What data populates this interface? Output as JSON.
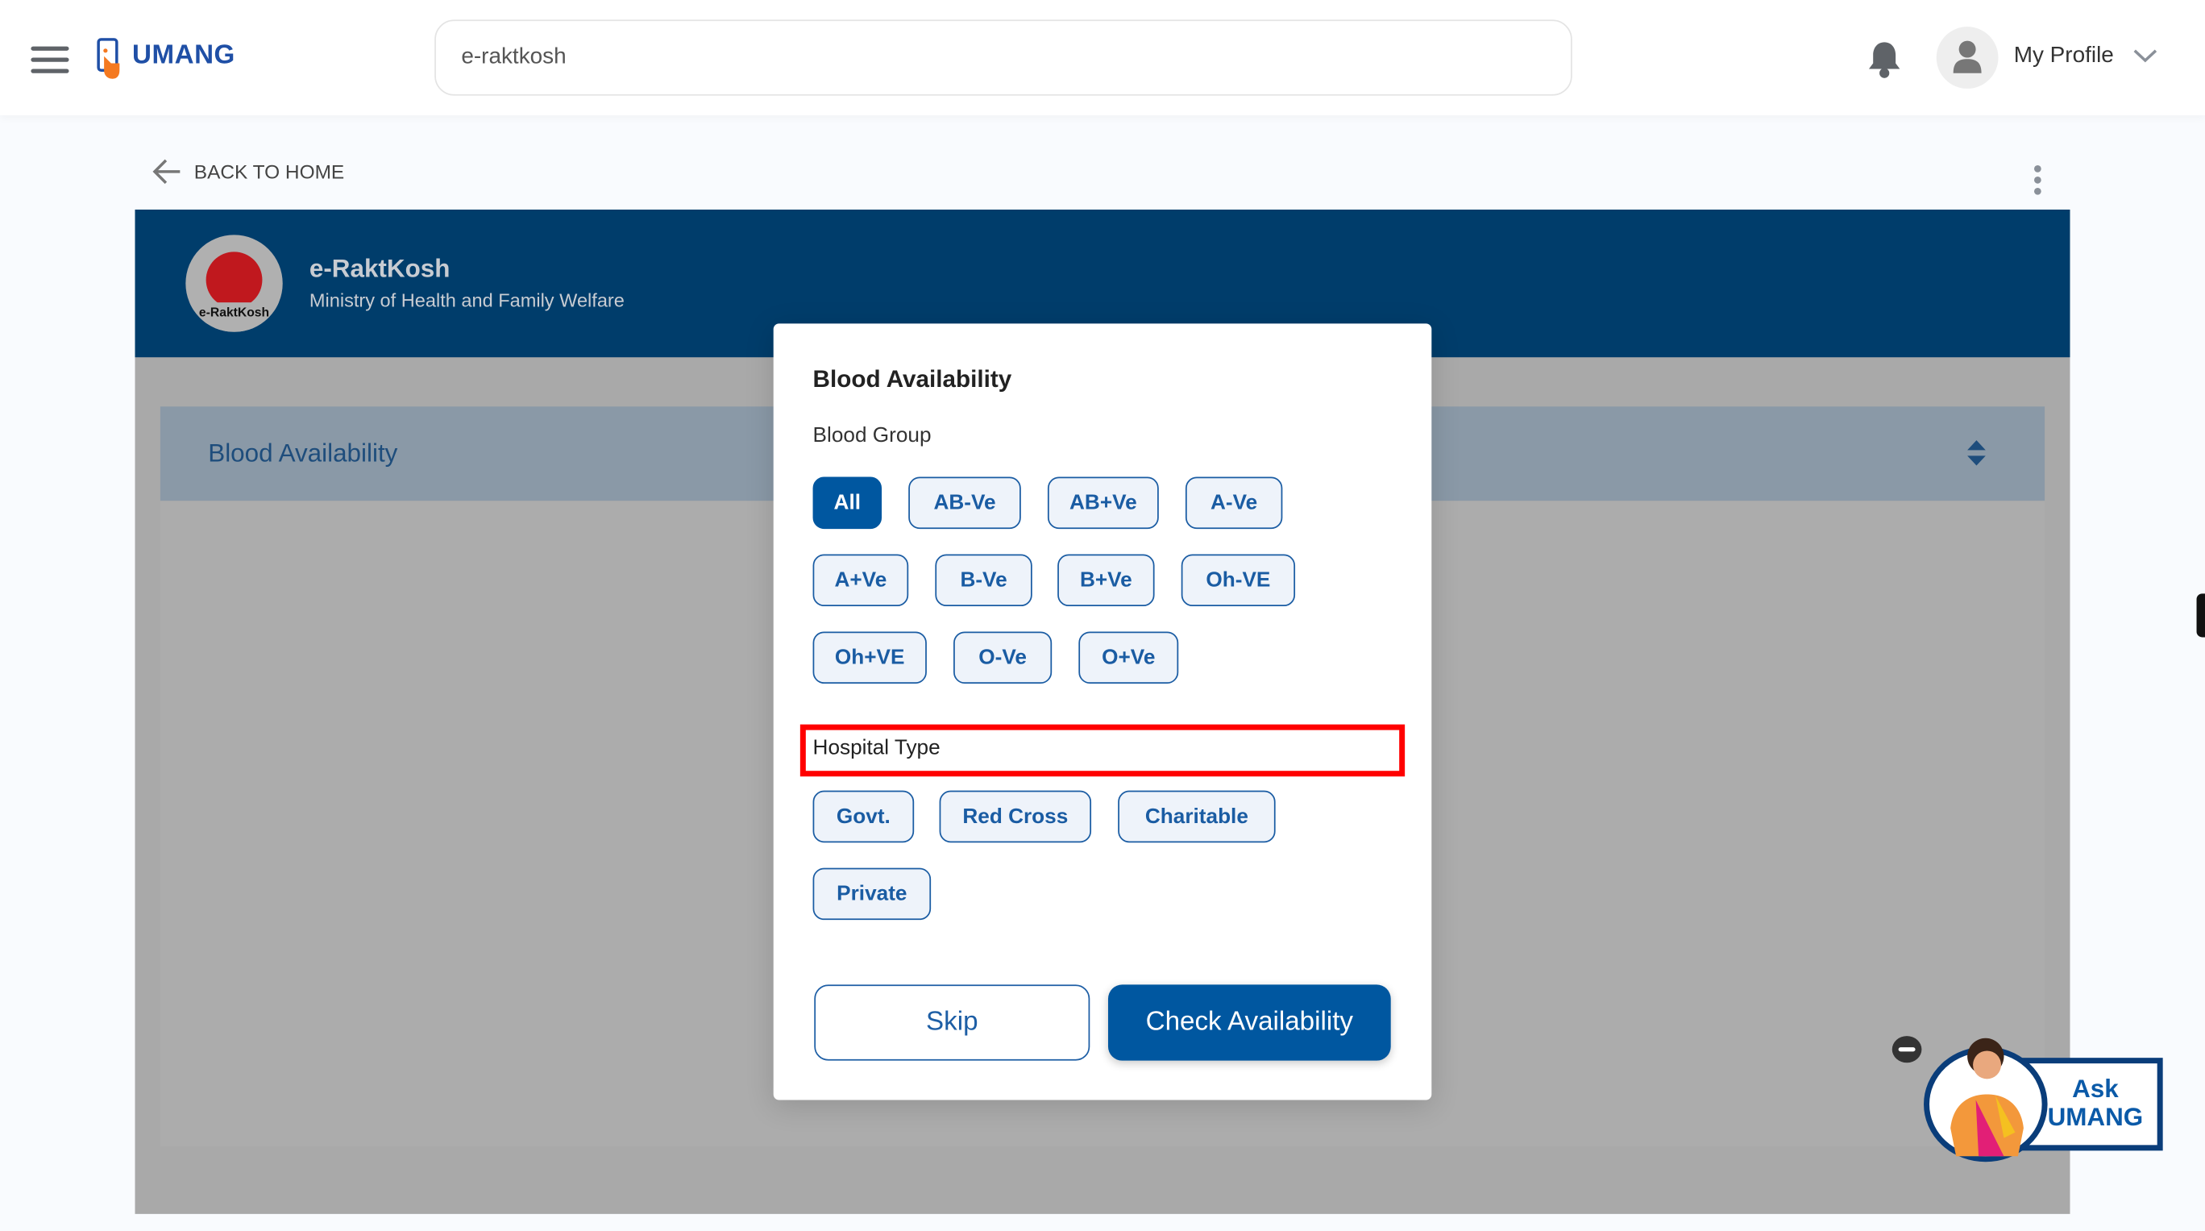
{
  "header": {
    "brand": "UMANG",
    "search_value": "e-raktkosh",
    "profile_label": "My Profile"
  },
  "nav": {
    "back_label": "BACK TO HOME"
  },
  "service": {
    "title": "e-RaktKosh",
    "subtitle": "Ministry of Health and Family Welfare",
    "logo_text": "e-RaktKosh",
    "accordion_title": "Blood Availability"
  },
  "modal": {
    "title": "Blood Availability",
    "blood_group_label": "Blood Group",
    "blood_groups": [
      "All",
      "AB-Ve",
      "AB+Ve",
      "A-Ve",
      "A+Ve",
      "B-Ve",
      "B+Ve",
      "Oh-VE",
      "Oh+VE",
      "O-Ve",
      "O+Ve"
    ],
    "selected_blood_group": "All",
    "hospital_type_label": "Hospital Type",
    "hospital_types": [
      "Govt.",
      "Red Cross",
      "Charitable",
      "Private"
    ],
    "skip_label": "Skip",
    "check_label": "Check Availability"
  },
  "assistant": {
    "label_line1": "Ask",
    "label_line2": "UMANG"
  },
  "colors": {
    "brand": "#1f4fa6",
    "primary": "#0057a0",
    "banner": "#003d6b",
    "highlight": "#ff0000"
  }
}
